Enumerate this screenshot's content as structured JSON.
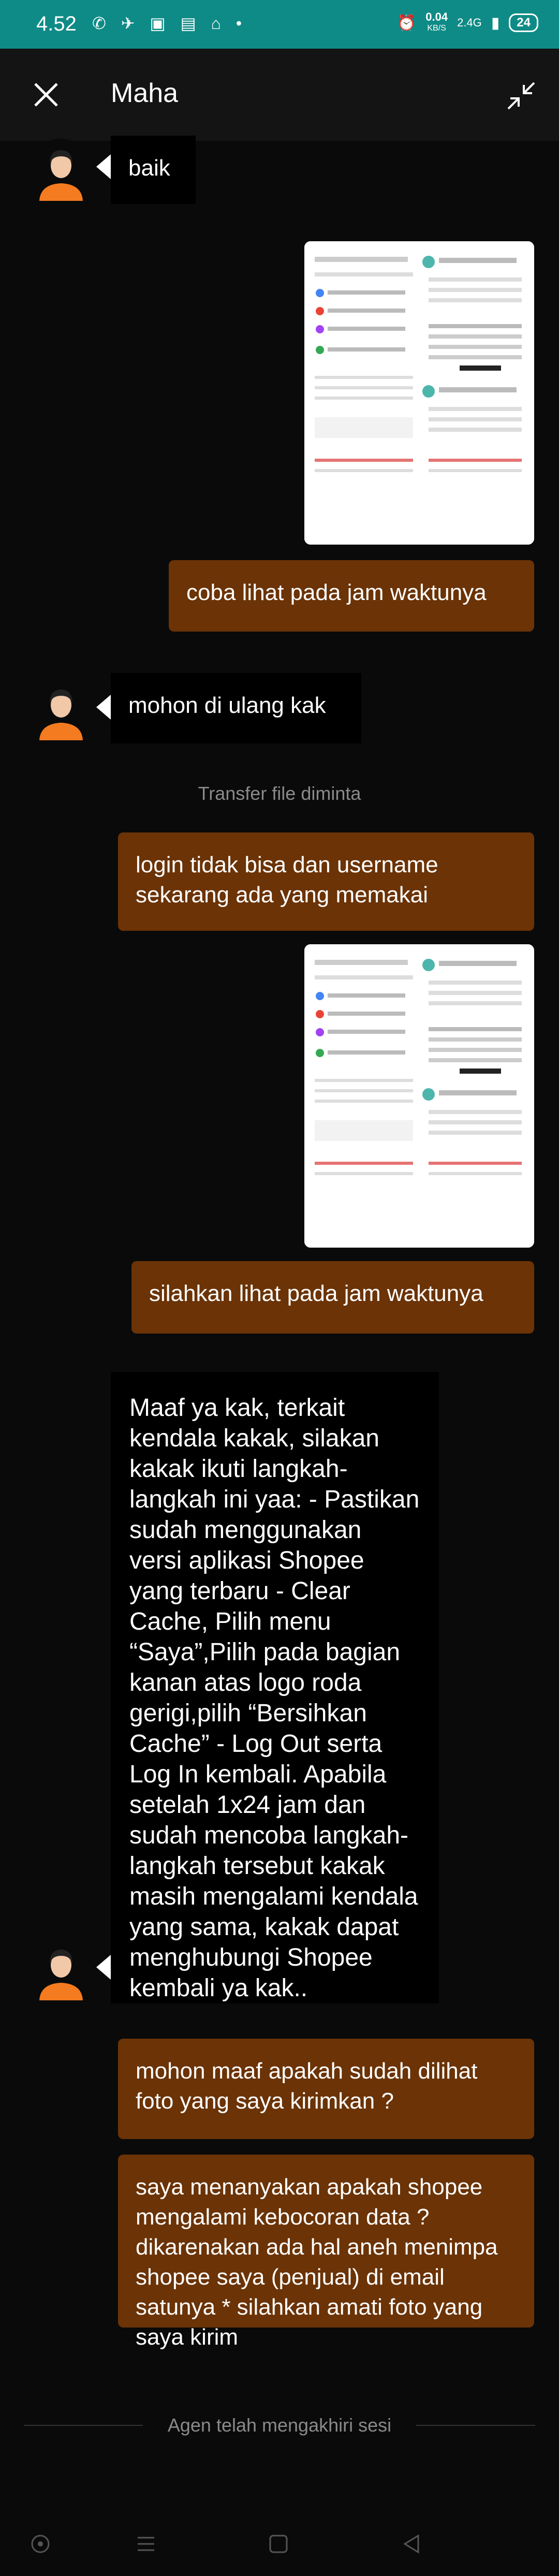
{
  "status_bar": {
    "time": "4.52",
    "net_speed": "0.04",
    "net_unit": "KB/S",
    "signal": "2.4G",
    "battery": "24"
  },
  "header": {
    "title": "Maha"
  },
  "messages": {
    "m1": "baik",
    "m2": "coba lihat pada jam waktunya",
    "m3": "mohon di ulang kak",
    "sys1": "Transfer file diminta",
    "m4": "login tidak bisa dan username sekarang ada yang memakai",
    "m5": "silahkan lihat pada jam waktunya",
    "m6": "Maaf ya kak, terkait kendala kakak, silakan kakak ikuti langkah-langkah ini yaa: - Pastikan sudah menggunakan versi aplikasi Shopee yang terbaru - Clear Cache, Pilih menu “Saya”,Pilih pada bagian kanan atas logo roda gerigi,pilih “Bersihkan Cache” - Log Out serta Log In kembali. Apabila setelah 1x24 jam dan sudah mencoba langkah-langkah tersebut kakak masih mengalami kendala yang sama, kakak dapat menghubungi Shopee kembali ya kak..",
    "m7": "mohon maaf apakah sudah dilihat foto yang saya kirimkan ?",
    "m8": "saya menanyakan apakah shopee mengalami kebocoran data ? dikarenakan ada hal aneh menimpa shopee saya (penjual) di email satunya * silahkan amati foto yang saya kirim",
    "sys2": "Agen telah mengakhiri sesi"
  },
  "colors": {
    "status_bar": "#0e8b86",
    "user_bubble": "#6b3306",
    "agent_bubble": "#000000",
    "background": "#0a0a0a"
  },
  "icons": {
    "close": "close-icon",
    "collapse": "collapse-icon",
    "nav": [
      "nav-circle-icon",
      "nav-menu-icon",
      "nav-home-icon",
      "nav-back-icon"
    ]
  }
}
